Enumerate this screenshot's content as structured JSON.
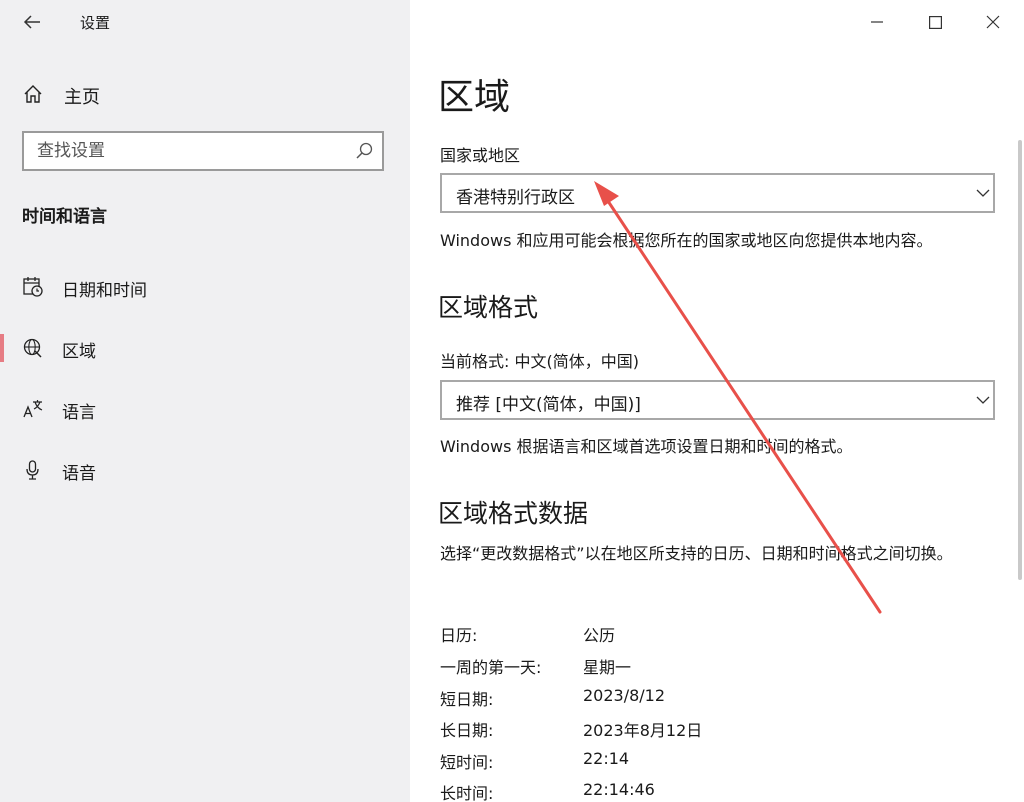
{
  "window": {
    "title": "设置"
  },
  "sidebar": {
    "home_label": "主页",
    "search_placeholder": "查找设置",
    "section_heading": "时间和语言",
    "items": [
      {
        "label": "日期和时间",
        "icon": "calendar-clock-icon"
      },
      {
        "label": "区域",
        "icon": "globe-region-icon",
        "selected": true
      },
      {
        "label": "语言",
        "icon": "language-icon"
      },
      {
        "label": "语音",
        "icon": "microphone-icon"
      }
    ]
  },
  "main": {
    "page_title": "区域",
    "country": {
      "label": "国家或地区",
      "value": "香港特别行政区",
      "description": "Windows 和应用可能会根据您所在的国家或地区向您提供本地内容。"
    },
    "format": {
      "title": "区域格式",
      "label": "当前格式: 中文(简体，中国)",
      "value": "推荐 [中文(简体，中国)]",
      "description": "Windows 根据语言和区域首选项设置日期和时间的格式。"
    },
    "format_data": {
      "title": "区域格式数据",
      "description": "选择“更改数据格式”以在地区所支持的日历、日期和时间格式之间切换。",
      "rows": [
        {
          "key": "日历:",
          "value": "公历"
        },
        {
          "key": "一周的第一天:",
          "value": "星期一"
        },
        {
          "key": "短日期:",
          "value": "2023/8/12"
        },
        {
          "key": "长日期:",
          "value": "2023年8月12日"
        },
        {
          "key": "短时间:",
          "value": "22:14"
        },
        {
          "key": "长时间:",
          "value": "22:14:46"
        }
      ]
    }
  },
  "colors": {
    "sidebar_bg": "#f0f0f2",
    "selection_indicator": "#e67c84",
    "annotation_arrow": "#e8504a"
  }
}
